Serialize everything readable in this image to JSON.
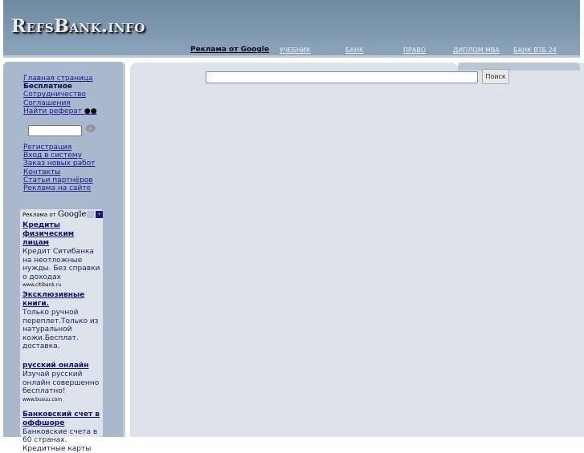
{
  "header": {
    "logo": "RefsBank.info",
    "nav": [
      "Реклама от Google",
      "УЧЕБНИК",
      "БАНК",
      "ПРАВО",
      "ДИПЛОМ MBA",
      "БАНК ВТБ 24"
    ]
  },
  "sidebar": {
    "links1": [
      "Главная страница",
      "Бесплатное",
      "Сотрудничество",
      "Соглашения",
      "Найти реферат"
    ],
    "search_value": "",
    "links2": [
      "Регистрация",
      "Вход в систему",
      "Заказ новых работ",
      "Контакты",
      "Статьи партнёров",
      "Реклама на сайте"
    ]
  },
  "ads": {
    "header_prefix": "Реклама от",
    "header_brand": "Google",
    "items": [
      {
        "title": "Кредиты физическим лицам",
        "desc": "Кредит Ситибанка на неотложные нужды. Без справки о доходах",
        "url": "www.citibank.ru"
      },
      {
        "title": "Эксклюзивные книги.",
        "desc": "Только ручной переплет.Только из натуральной кожи.Бесплат. доставка.",
        "url": ""
      },
      {
        "title": "русский онлайн",
        "desc": "Изучай русский онлайн совершенно бесплатно!",
        "url": "www.busuu.com"
      },
      {
        "title": "Банковский счет в оффшоре",
        "desc": "Банковские счета в 60 странах. Кредитные карты",
        "url": ""
      }
    ]
  },
  "search": {
    "value": "",
    "button": "Поиск"
  }
}
